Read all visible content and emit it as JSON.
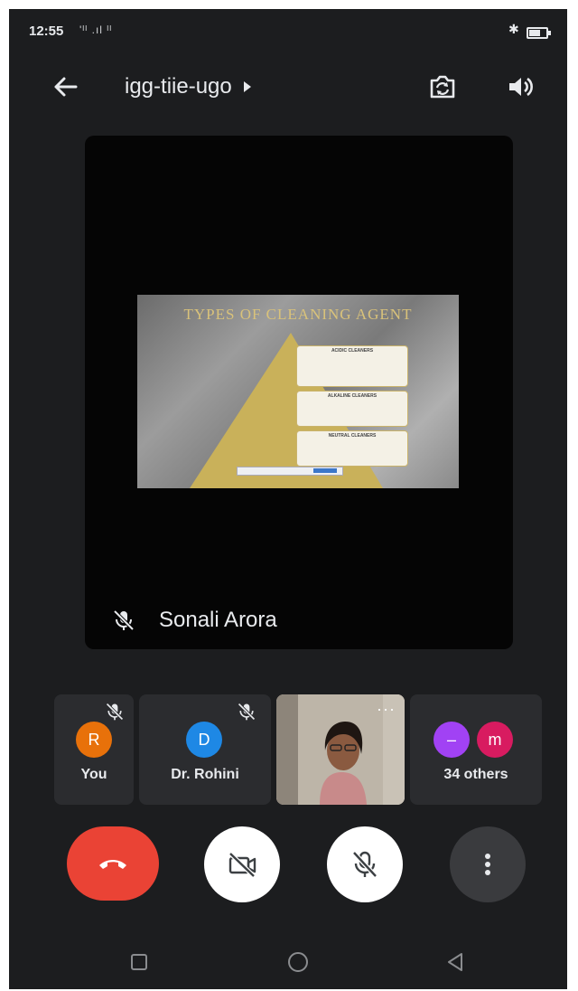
{
  "status_bar": {
    "time": "12:55",
    "signal_text": "'ᴵᴵ .ıl ᴵᴵ",
    "icons": [
      "bluetooth-icon",
      "battery-icon"
    ]
  },
  "app_bar": {
    "meeting_code": "igg-tiie-ugo",
    "icons": [
      "back-arrow-icon",
      "caret-right-icon",
      "switch-camera-icon",
      "speaker-icon"
    ]
  },
  "main_tile": {
    "presenter_name": "Sonali Arora",
    "presenter_muted": true,
    "slide": {
      "title": "TYPES OF CLEANING AGENT",
      "box_headings": [
        "ACIDIC CLEANERS",
        "ALKALINE CLEANERS",
        "NEUTRAL CLEANERS"
      ]
    }
  },
  "participants": [
    {
      "label": "You",
      "initial": "R",
      "color": "#e8710a",
      "muted": true
    },
    {
      "label": "Dr. Rohini",
      "initial": "D",
      "color": "#1e88e5",
      "muted": true
    },
    {
      "label": "",
      "type": "camera",
      "menu": "···"
    },
    {
      "label": "34 others",
      "initials": [
        "–",
        "m"
      ],
      "colors": [
        "#a142f4",
        "#d81b60"
      ]
    }
  ],
  "controls": {
    "icons": [
      "end-call-icon",
      "camera-off-icon",
      "mic-off-icon",
      "more-vert-icon"
    ],
    "colors": {
      "end_call": "#ea4335",
      "button_bg": "#ffffff",
      "more_bg": "#3a3b3e"
    }
  },
  "nav_bar": {
    "icons": [
      "recents-square-icon",
      "home-circle-icon",
      "back-triangle-icon"
    ]
  },
  "colors": {
    "background": "#1c1d1f",
    "tile_bg": "#2b2c2f",
    "main_tile_bg": "#050505",
    "text": "#e8eaed"
  }
}
